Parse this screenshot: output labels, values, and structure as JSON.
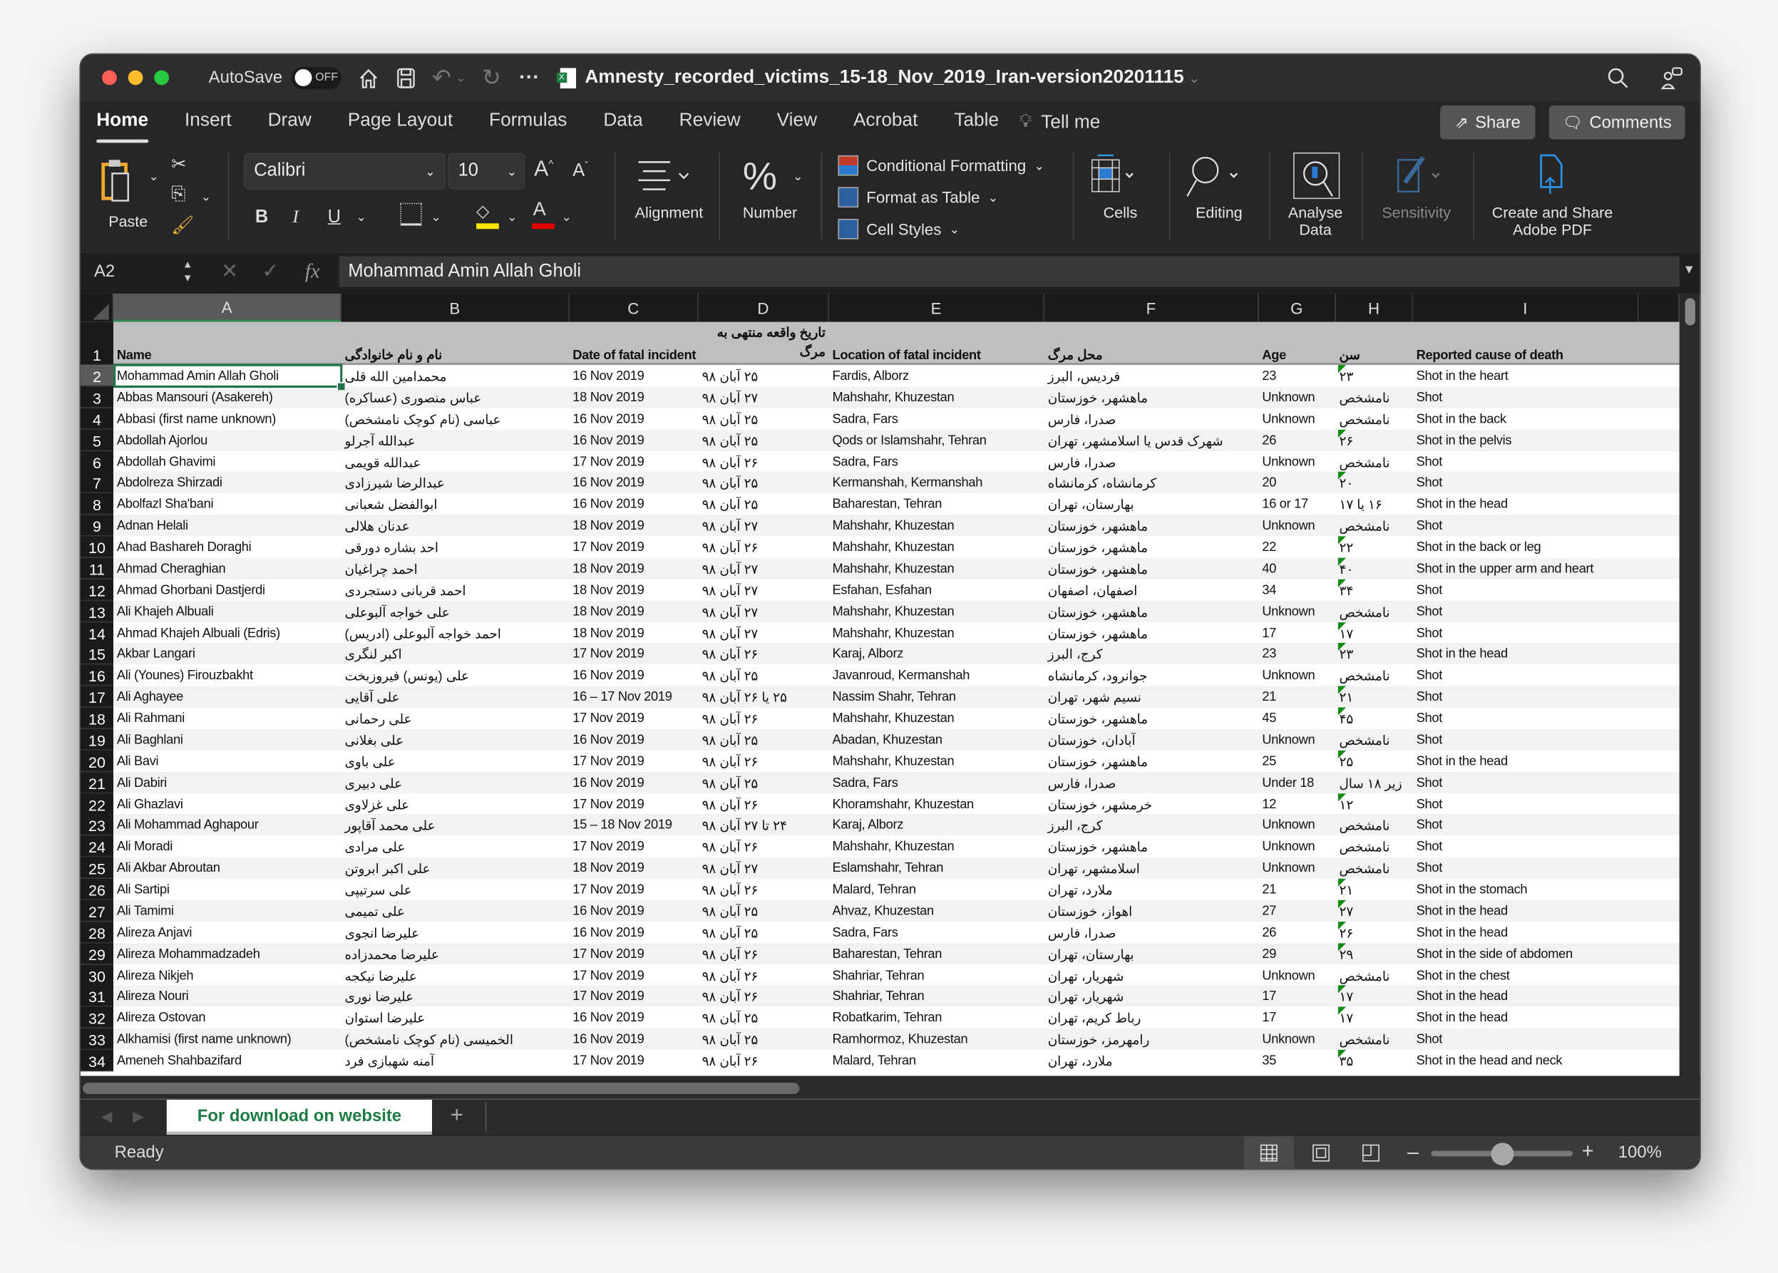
{
  "titlebar": {
    "autosave_label": "AutoSave",
    "autosave_state": "OFF",
    "filename": "Amnesty_recorded_victims_15-18_Nov_2019_Iran-version20201115"
  },
  "menu_tabs": [
    "Home",
    "Insert",
    "Draw",
    "Page Layout",
    "Formulas",
    "Data",
    "Review",
    "View",
    "Acrobat",
    "Table"
  ],
  "tell_me": "Tell me",
  "share_label": "Share",
  "comments_label": "Comments",
  "ribbon": {
    "paste": "Paste",
    "font_name": "Calibri",
    "font_size": "10",
    "alignment": "Alignment",
    "number": "Number",
    "conditional_formatting": "Conditional Formatting",
    "format_as_table": "Format as Table",
    "cell_styles": "Cell Styles",
    "cells": "Cells",
    "editing": "Editing",
    "analyse_data": "Analyse Data",
    "sensitivity": "Sensitivity",
    "create_share_pdf": "Create and Share Adobe PDF",
    "fill_color": "#ffe600",
    "font_color": "#e00000"
  },
  "formula_bar": {
    "name_box": "A2",
    "fx": "fx",
    "value": "Mohammad Amin Allah Gholi"
  },
  "columns": [
    "A",
    "B",
    "C",
    "D",
    "E",
    "F",
    "G",
    "H",
    "I"
  ],
  "header_row": {
    "number": "1",
    "cells": [
      "Name",
      "نام و نام خانوادگی",
      "Date of fatal incident",
      "تاریخ واقعه منتهی به مرگ",
      "Location of fatal incident",
      "محل مرگ",
      "Age",
      "سن",
      "Reported cause of death"
    ]
  },
  "rows": [
    {
      "n": "2",
      "c": [
        "Mohammad Amin Allah Gholi",
        "محمدامین الله قلی",
        "16 Nov 2019",
        "۲۵ آبان ۹۸",
        "Fardis, Alborz",
        "فردیس، البرز",
        "23",
        "۲۳",
        "Shot in the heart"
      ]
    },
    {
      "n": "3",
      "c": [
        "Abbas Mansouri (Asakereh)",
        "عباس منصوری (عساکره)",
        "18 Nov 2019",
        "۲۷ آبان ۹۸",
        "Mahshahr, Khuzestan",
        "ماهشهر، خوزستان",
        "Unknown",
        "نامشخص",
        "Shot"
      ]
    },
    {
      "n": "4",
      "c": [
        "Abbasi (first name unknown)",
        "عباسی (نام کوچک نامشخص)",
        "16 Nov 2019",
        "۲۵ آبان ۹۸",
        "Sadra, Fars",
        "صدرا، فارس",
        "Unknown",
        "نامشخص",
        "Shot in the back"
      ]
    },
    {
      "n": "5",
      "c": [
        "Abdollah Ajorlou",
        "عبدالله آجرلو",
        "16 Nov 2019",
        "۲۵ آبان ۹۸",
        "Qods or Islamshahr, Tehran",
        "شهرک قدس یا اسلامشهر، تهران",
        "26",
        "۲۶",
        "Shot in the pelvis"
      ]
    },
    {
      "n": "6",
      "c": [
        "Abdollah Ghavimi",
        "عبدالله قویمی",
        "17 Nov 2019",
        "۲۶ آبان ۹۸",
        "Sadra, Fars",
        "صدرا، فارس",
        "Unknown",
        "نامشخص",
        "Shot"
      ]
    },
    {
      "n": "7",
      "c": [
        "Abdolreza Shirzadi",
        "عبدالرضا شیرزادی",
        "16 Nov 2019",
        "۲۵ آبان ۹۸",
        "Kermanshah, Kermanshah",
        "کرمانشاه، کرمانشاه",
        "20",
        "۲۰",
        "Shot"
      ]
    },
    {
      "n": "8",
      "c": [
        "Abolfazl Sha'bani",
        "ابوالفضل شعبانی",
        "16 Nov 2019",
        "۲۵ آبان ۹۸",
        "Baharestan, Tehran",
        "بهارستان، تهران",
        "16 or 17",
        "۱۶ یا ۱۷",
        "Shot in the head"
      ]
    },
    {
      "n": "9",
      "c": [
        "Adnan Helali",
        "عدنان هلالی",
        "18 Nov 2019",
        "۲۷ آبان ۹۸",
        "Mahshahr, Khuzestan",
        "ماهشهر، خوزستان",
        "Unknown",
        "نامشخص",
        "Shot"
      ]
    },
    {
      "n": "10",
      "c": [
        "Ahad Bashareh Doraghi",
        "احد بشاره دورقی",
        "17 Nov 2019",
        "۲۶ آبان ۹۸",
        "Mahshahr, Khuzestan",
        "ماهشهر، خوزستان",
        "22",
        "۲۲",
        "Shot in the back or leg"
      ]
    },
    {
      "n": "11",
      "c": [
        "Ahmad Cheraghian",
        "احمد چراغیان",
        "18 Nov 2019",
        "۲۷ آبان ۹۸",
        "Mahshahr, Khuzestan",
        "ماهشهر، خوزستان",
        "40",
        "۴۰",
        "Shot in the upper arm and heart"
      ]
    },
    {
      "n": "12",
      "c": [
        "Ahmad Ghorbani Dastjerdi",
        "احمد قربانی دستجردی",
        "18 Nov 2019",
        "۲۷ آبان ۹۸",
        "Esfahan, Esfahan",
        "اصفهان، اصفهان",
        "34",
        "۳۴",
        "Shot"
      ]
    },
    {
      "n": "13",
      "c": [
        "Ali Khajeh Albuali",
        "علی خواجه آلبوعلی",
        "18 Nov 2019",
        "۲۷ آبان ۹۸",
        "Mahshahr, Khuzestan",
        "ماهشهر، خوزستان",
        "Unknown",
        "نامشخص",
        "Shot"
      ]
    },
    {
      "n": "14",
      "c": [
        "Ahmad Khajeh Albuali (Edris)",
        "احمد خواجه آلبوعلی (ادریس)",
        "18 Nov 2019",
        "۲۷ آبان ۹۸",
        "Mahshahr, Khuzestan",
        "ماهشهر، خوزستان",
        "17",
        "۱۷",
        "Shot"
      ]
    },
    {
      "n": "15",
      "c": [
        "Akbar Langari",
        "اکبر لنگری",
        "17 Nov 2019",
        "۲۶ آبان ۹۸",
        "Karaj, Alborz",
        "کرج، البرز",
        "23",
        "۲۳",
        "Shot in the head"
      ]
    },
    {
      "n": "16",
      "c": [
        "Ali (Younes) Firouzbakht",
        "علی (یونس) فیروزبخت",
        "16 Nov 2019",
        "۲۵ آبان ۹۸",
        "Javanroud, Kermanshah",
        "جوانرود، کرمانشاه",
        "Unknown",
        "نامشخص",
        "Shot"
      ]
    },
    {
      "n": "17",
      "c": [
        "Ali Aghayee",
        "علی آقایی",
        "16 – 17 Nov 2019",
        "۲۵ یا ۲۶ آبان ۹۸",
        "Nassim Shahr, Tehran",
        "نسیم شهر، تهران",
        "21",
        "۲۱",
        "Shot"
      ]
    },
    {
      "n": "18",
      "c": [
        "Ali Rahmani",
        "علی رحمانی",
        "17 Nov 2019",
        "۲۶ آبان ۹۸",
        "Mahshahr, Khuzestan",
        "ماهشهر، خوزستان",
        "45",
        "۴۵",
        "Shot"
      ]
    },
    {
      "n": "19",
      "c": [
        "Ali Baghlani",
        "علی بغلانی",
        "16 Nov 2019",
        "۲۵ آبان ۹۸",
        "Abadan, Khuzestan",
        "آبادان، خوزستان",
        "Unknown",
        "نامشخص",
        "Shot"
      ]
    },
    {
      "n": "20",
      "c": [
        "Ali Bavi",
        "علی باوی",
        "17 Nov 2019",
        "۲۶ آبان ۹۸",
        "Mahshahr, Khuzestan",
        "ماهشهر، خوزستان",
        "25",
        "۲۵",
        "Shot in the head"
      ]
    },
    {
      "n": "21",
      "c": [
        "Ali Dabiri",
        "علی دبیری",
        "16 Nov 2019",
        "۲۵ آبان ۹۸",
        "Sadra, Fars",
        "صدرا، فارس",
        "Under 18",
        "زیر ۱۸ سال",
        "Shot"
      ]
    },
    {
      "n": "22",
      "c": [
        "Ali Ghazlavi",
        "علی غزلاوی",
        "17 Nov 2019",
        "۲۶ آبان ۹۸",
        "Khoramshahr, Khuzestan",
        "خرمشهر، خوزستان",
        "12",
        "۱۲",
        "Shot"
      ]
    },
    {
      "n": "23",
      "c": [
        "Ali Mohammad Aghapour",
        "علی محمد آقاپور",
        "15 – 18 Nov 2019",
        "۲۴ تا ۲۷ آبان ۹۸",
        "Karaj, Alborz",
        "کرج، البرز",
        "Unknown",
        "نامشخص",
        "Shot"
      ]
    },
    {
      "n": "24",
      "c": [
        "Ali Moradi",
        "علی مرادی",
        "17 Nov 2019",
        "۲۶ آبان ۹۸",
        "Mahshahr, Khuzestan",
        "ماهشهر، خوزستان",
        "Unknown",
        "نامشخص",
        "Shot"
      ]
    },
    {
      "n": "25",
      "c": [
        "Ali Akbar Abroutan",
        "علی اکبر ابروتن",
        "18 Nov 2019",
        "۲۷ آبان ۹۸",
        "Eslamshahr, Tehran",
        "اسلامشهر، تهران",
        "Unknown",
        "نامشخص",
        "Shot"
      ]
    },
    {
      "n": "26",
      "c": [
        "Ali Sartipi",
        "علی سرتیپی",
        "17 Nov 2019",
        "۲۶ آبان ۹۸",
        "Malard, Tehran",
        "ملارد، تهران",
        "21",
        "۲۱",
        "Shot in the stomach"
      ]
    },
    {
      "n": "27",
      "c": [
        "Ali Tamimi",
        "علی تمیمی",
        "16 Nov 2019",
        "۲۵ آبان ۹۸",
        "Ahvaz, Khuzestan",
        "اهواز، خوزستان",
        "27",
        "۲۷",
        "Shot in the head"
      ]
    },
    {
      "n": "28",
      "c": [
        "Alireza Anjavi",
        "علیرضا انجوی",
        "16 Nov 2019",
        "۲۵ آبان ۹۸",
        "Sadra, Fars",
        "صدرا، فارس",
        "26",
        "۲۶",
        "Shot in the head"
      ]
    },
    {
      "n": "29",
      "c": [
        "Alireza Mohammadzadeh",
        "علیرضا محمدزاده",
        "17 Nov 2019",
        "۲۶ آبان ۹۸",
        "Baharestan, Tehran",
        "بهارستان، تهران",
        "29",
        "۲۹",
        "Shot in the side of abdomen"
      ]
    },
    {
      "n": "30",
      "c": [
        "Alireza Nikjeh",
        "علیرضا نیکجه",
        "17 Nov 2019",
        "۲۶ آبان ۹۸",
        "Shahriar, Tehran",
        "شهریار، تهران",
        "Unknown",
        "نامشخص",
        "Shot in the chest"
      ]
    },
    {
      "n": "31",
      "c": [
        "Alireza Nouri",
        "علیرضا نوری",
        "17 Nov 2019",
        "۲۶ آبان ۹۸",
        "Shahriar, Tehran",
        "شهریار، تهران",
        "17",
        "۱۷",
        "Shot in the head"
      ]
    },
    {
      "n": "32",
      "c": [
        "Alireza Ostovan",
        "علیرضا استوان",
        "16 Nov 2019",
        "۲۵ آبان ۹۸",
        "Robatkarim, Tehran",
        "رباط کریم، تهران",
        "17",
        "۱۷",
        "Shot in the head"
      ]
    },
    {
      "n": "33",
      "c": [
        "Alkhamisi (first name unknown)",
        "الخمیسی (نام کوچک نامشخص)",
        "16 Nov 2019",
        "۲۵ آبان ۹۸",
        "Ramhormoz, Khuzestan",
        "رامهرمز، خوزستان",
        "Unknown",
        "نامشخص",
        "Shot"
      ]
    },
    {
      "n": "34",
      "c": [
        "Ameneh Shahbazifard",
        "آمنه شهبازی فرد",
        "17 Nov 2019",
        "۲۶ آبان ۹۸",
        "Malard, Tehran",
        "ملارد، تهران",
        "35",
        "۳۵",
        "Shot in the head and neck"
      ]
    }
  ],
  "sheet_tabs": [
    "For download on website"
  ],
  "status": {
    "ready": "Ready",
    "zoom": "100%",
    "zoom_percent": 100
  },
  "colors": {
    "accent_green": "#217346",
    "sheet_tab_text": "#1e7b45",
    "error_indicator": "#138a13"
  }
}
